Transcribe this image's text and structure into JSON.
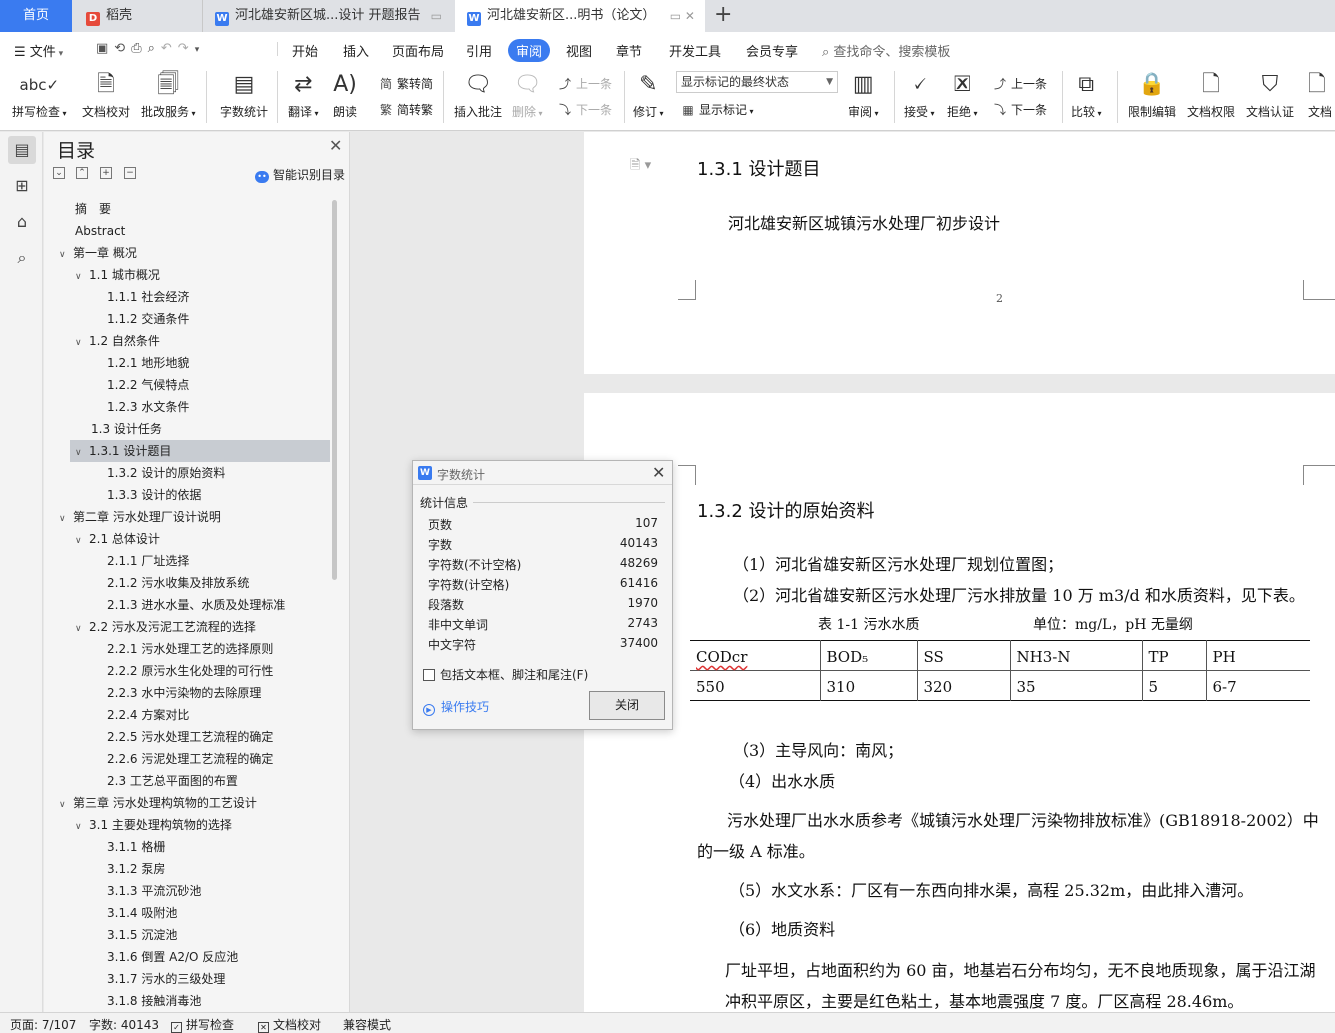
{
  "tabs": {
    "home": "首页",
    "daoke": "稻壳",
    "doc1": "河北雄安新区城...设计 开题报告",
    "doc2": "河北雄安新区...明书（论文）",
    "add": "+"
  },
  "menu": {
    "file": "文件",
    "items": [
      "开始",
      "插入",
      "页面布局",
      "引用",
      "审阅",
      "视图",
      "章节",
      "开发工具",
      "会员专享"
    ],
    "search": "查找命令、搜索模板"
  },
  "ribbon": {
    "spell": "拼写检查",
    "proof": "文档校对",
    "batch": "批改服务",
    "count": "字数统计",
    "translate": "翻译",
    "read": "朗读",
    "trad": "繁转简",
    "simp": "简转繁",
    "insert_comment": "插入批注",
    "delete": "删除",
    "prev": "上一条",
    "next": "下一条",
    "revise": "修订",
    "mark_state": "显示标记的最终状态",
    "show_marks": "显示标记",
    "review": "审阅",
    "accept": "接受",
    "reject": "拒绝",
    "prev2": "上一条",
    "next2": "下一条",
    "compare": "比较",
    "restrict": "限制编辑",
    "rights": "文档权限",
    "cert": "文档认证",
    "more": "文档"
  },
  "toc": {
    "title": "目录",
    "smart": "智能识别目录",
    "items": [
      {
        "text": "摘　要",
        "level": 0,
        "caret": ""
      },
      {
        "text": "Abstract",
        "level": 0,
        "caret": ""
      },
      {
        "text": "第一章  概况",
        "level": 0,
        "caret": "v"
      },
      {
        "text": "1.1 城市概况",
        "level": 1,
        "caret": "v"
      },
      {
        "text": "1.1.1 社会经济",
        "level": 2,
        "caret": ""
      },
      {
        "text": "1.1.2 交通条件",
        "level": 2,
        "caret": ""
      },
      {
        "text": "1.2 自然条件",
        "level": 1,
        "caret": "v"
      },
      {
        "text": "1.2.1 地形地貌",
        "level": 2,
        "caret": ""
      },
      {
        "text": "1.2.2 气候特点",
        "level": 2,
        "caret": ""
      },
      {
        "text": "1.2.3 水文条件",
        "level": 2,
        "caret": ""
      },
      {
        "text": "1.3 设计任务",
        "level": 1,
        "caret": ""
      },
      {
        "text": "1.3.1 设计题目",
        "level": 1,
        "caret": "v",
        "selected": true
      },
      {
        "text": "1.3.2 设计的原始资料",
        "level": 2,
        "caret": ""
      },
      {
        "text": "1.3.3 设计的依据",
        "level": 2,
        "caret": ""
      },
      {
        "text": "第二章  污水处理厂设计说明",
        "level": 0,
        "caret": "v"
      },
      {
        "text": "2.1 总体设计",
        "level": 1,
        "caret": "v"
      },
      {
        "text": "2.1.1 厂址选择",
        "level": 2,
        "caret": ""
      },
      {
        "text": "2.1.2 污水收集及排放系统",
        "level": 2,
        "caret": ""
      },
      {
        "text": "2.1.3 进水水量、水质及处理标准",
        "level": 2,
        "caret": ""
      },
      {
        "text": "2.2 污水及污泥工艺流程的选择",
        "level": 1,
        "caret": "v"
      },
      {
        "text": "2.2.1 污水处理工艺的选择原则",
        "level": 2,
        "caret": ""
      },
      {
        "text": "2.2.2 原污水生化处理的可行性",
        "level": 2,
        "caret": ""
      },
      {
        "text": "2.2.3 水中污染物的去除原理",
        "level": 2,
        "caret": ""
      },
      {
        "text": "2.2.4 方案对比",
        "level": 2,
        "caret": ""
      },
      {
        "text": "2.2.5 污水处理工艺流程的确定",
        "level": 2,
        "caret": ""
      },
      {
        "text": "2.2.6 污泥处理工艺流程的确定",
        "level": 2,
        "caret": ""
      },
      {
        "text": "2.3 工艺总平面图的布置",
        "level": 2,
        "caret": ""
      },
      {
        "text": "第三章  污水处理构筑物的工艺设计",
        "level": 0,
        "caret": "v"
      },
      {
        "text": "3.1 主要处理构筑物的选择",
        "level": 1,
        "caret": "v"
      },
      {
        "text": "3.1.1 格栅",
        "level": 2,
        "caret": ""
      },
      {
        "text": "3.1.2 泵房",
        "level": 2,
        "caret": ""
      },
      {
        "text": "3.1.3 平流沉砂池",
        "level": 2,
        "caret": ""
      },
      {
        "text": "3.1.4 吸附池",
        "level": 2,
        "caret": ""
      },
      {
        "text": "3.1.5 沉淀池",
        "level": 2,
        "caret": ""
      },
      {
        "text": "3.1.6 倒置 A2/O 反应池",
        "level": 2,
        "caret": ""
      },
      {
        "text": "3.1.7 污水的三级处理",
        "level": 2,
        "caret": ""
      },
      {
        "text": "3.1.8 接触消毒池",
        "level": 2,
        "caret": ""
      }
    ]
  },
  "doc": {
    "p1_heading": "1.3.1 设计题目",
    "p1_body": "河北雄安新区城镇污水处理厂初步设计",
    "page_number": "2",
    "p2_heading": "1.3.2 设计的原始资料",
    "line1": "（1）河北省雄安新区污水处理厂规划位置图；",
    "line2": "（2）河北省雄安新区污水处理厂污水排放量 10 万 m3/d 和水质资料，见下表。",
    "table_caption": "表 1-1 污水水质",
    "table_unit": "单位：mg/L，pH 无量纲",
    "table_headers": [
      "CODcr",
      "BOD₅",
      "SS",
      "NH3-N",
      "TP",
      "PH"
    ],
    "table_values": [
      "550",
      "310",
      "320",
      "35",
      "5",
      "6-7"
    ],
    "line3": "（3）主导风向：南风；",
    "line4": "（4）出水水质",
    "line5a": "污水处理厂出水水质参考《城镇污水处理厂污染物排放标准》(GB18918-2002）中",
    "line5b": "的一级 A 标准。",
    "line6": "（5）水文水系：厂区有一东西向排水渠，高程 25.32m，由此排入漕河。",
    "line7": "（6）地质资料",
    "line8a": "厂址平坦，占地面积约为 60 亩，地基岩石分布均匀，无不良地质现象，属于沿江湖",
    "line8b": "冲积平原区，主要是红色粘土，基本地震强度 7 度。厂区高程 28.46m。"
  },
  "dialog": {
    "title": "字数统计",
    "section": "统计信息",
    "stats": [
      {
        "label": "页数",
        "value": "107"
      },
      {
        "label": "字数",
        "value": "40143"
      },
      {
        "label": "字符数(不计空格)",
        "value": "48269"
      },
      {
        "label": "字符数(计空格)",
        "value": "61416"
      },
      {
        "label": "段落数",
        "value": "1970"
      },
      {
        "label": "非中文单词",
        "value": "2743"
      },
      {
        "label": "中文字符",
        "value": "37400"
      }
    ],
    "checkbox": "包括文本框、脚注和尾注(F)",
    "tips": "操作技巧",
    "close": "关闭"
  },
  "status": {
    "page": "页面: 7/107",
    "words": "字数: 40143",
    "spell": "拼写检查",
    "proof": "文档校对",
    "compat": "兼容模式"
  },
  "colors": {
    "accent": "#3a7bf0",
    "selected_row": "#c8ccd2"
  }
}
